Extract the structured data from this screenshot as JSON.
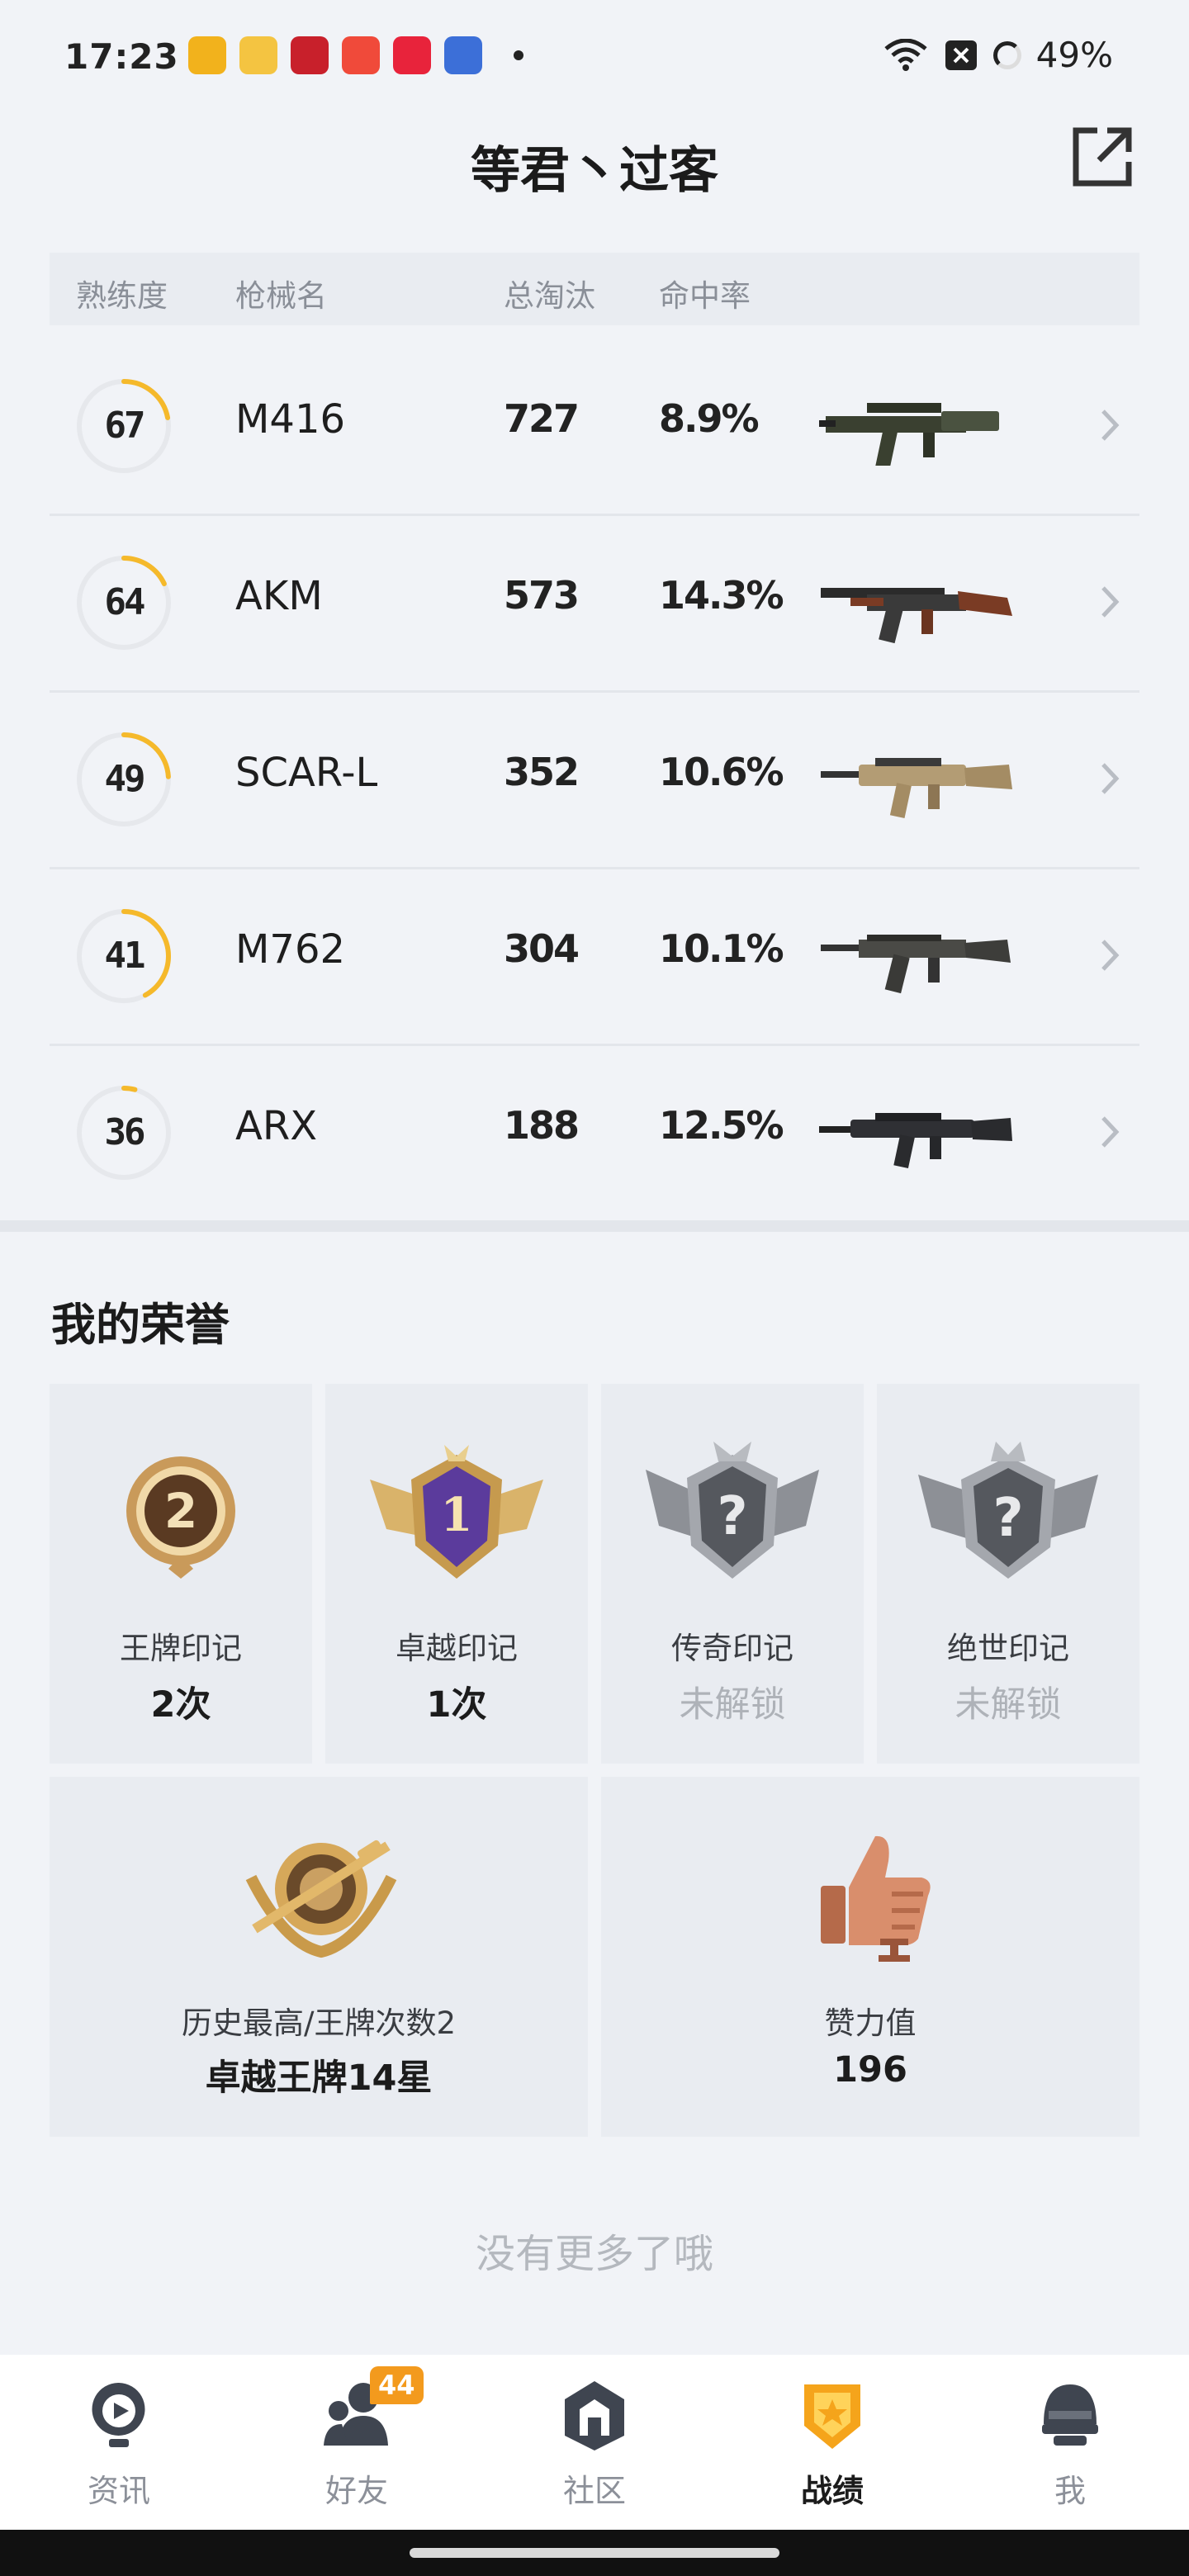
{
  "status_bar": {
    "time": "17:23",
    "battery": "49%",
    "app_icons": [
      {
        "name": "app-icon-yellow-target",
        "color": "#f2b21c"
      },
      {
        "name": "app-icon-book",
        "color": "#f4c441"
      },
      {
        "name": "app-icon-red-bag",
        "color": "#c8202b"
      },
      {
        "name": "app-icon-video",
        "color": "#f04a3a"
      },
      {
        "name": "app-icon-music",
        "color": "#e8233b"
      },
      {
        "name": "app-icon-game",
        "color": "#3c6fd8"
      }
    ]
  },
  "header": {
    "title": "等君丶过客"
  },
  "table": {
    "headers": {
      "mastery": "熟练度",
      "weapon": "枪械名",
      "kills": "总淘汰",
      "accuracy": "命中率"
    },
    "rows": [
      {
        "mastery": "67",
        "name": "M416",
        "kills": "727",
        "accuracy": "8.9%",
        "progress": 0.22
      },
      {
        "mastery": "64",
        "name": "AKM",
        "kills": "573",
        "accuracy": "14.3%",
        "progress": 0.18
      },
      {
        "mastery": "49",
        "name": "SCAR-L",
        "kills": "352",
        "accuracy": "10.6%",
        "progress": 0.24
      },
      {
        "mastery": "41",
        "name": "M762",
        "kills": "304",
        "accuracy": "10.1%",
        "progress": 0.42
      },
      {
        "mastery": "36",
        "name": "ARX",
        "kills": "188",
        "accuracy": "12.5%",
        "progress": 0.04
      }
    ]
  },
  "honors": {
    "title": "我的荣誉",
    "marks": [
      {
        "label": "王牌印记",
        "value": "2次",
        "locked": false
      },
      {
        "label": "卓越印记",
        "value": "1次",
        "locked": false
      },
      {
        "label": "传奇印记",
        "value": "未解锁",
        "locked": true
      },
      {
        "label": "绝世印记",
        "value": "未解锁",
        "locked": true
      }
    ],
    "best": {
      "label": "历史最高/王牌次数2",
      "value": "卓越王牌14星"
    },
    "likes": {
      "label": "赞力值",
      "value": "196"
    }
  },
  "footer_text": "没有更多了哦",
  "nav": {
    "items": [
      {
        "label": "资讯",
        "icon": "news-icon"
      },
      {
        "label": "好友",
        "icon": "friends-icon"
      },
      {
        "label": "社区",
        "icon": "community-icon"
      },
      {
        "label": "战绩",
        "icon": "record-icon",
        "active": true
      },
      {
        "label": "我",
        "icon": "profile-icon"
      }
    ],
    "friends_badge": "44"
  },
  "colors": {
    "accent": "#f5b92b",
    "ring_track": "#e6e8ec",
    "background": "#f1f3f7",
    "card": "#e9ecf1"
  }
}
